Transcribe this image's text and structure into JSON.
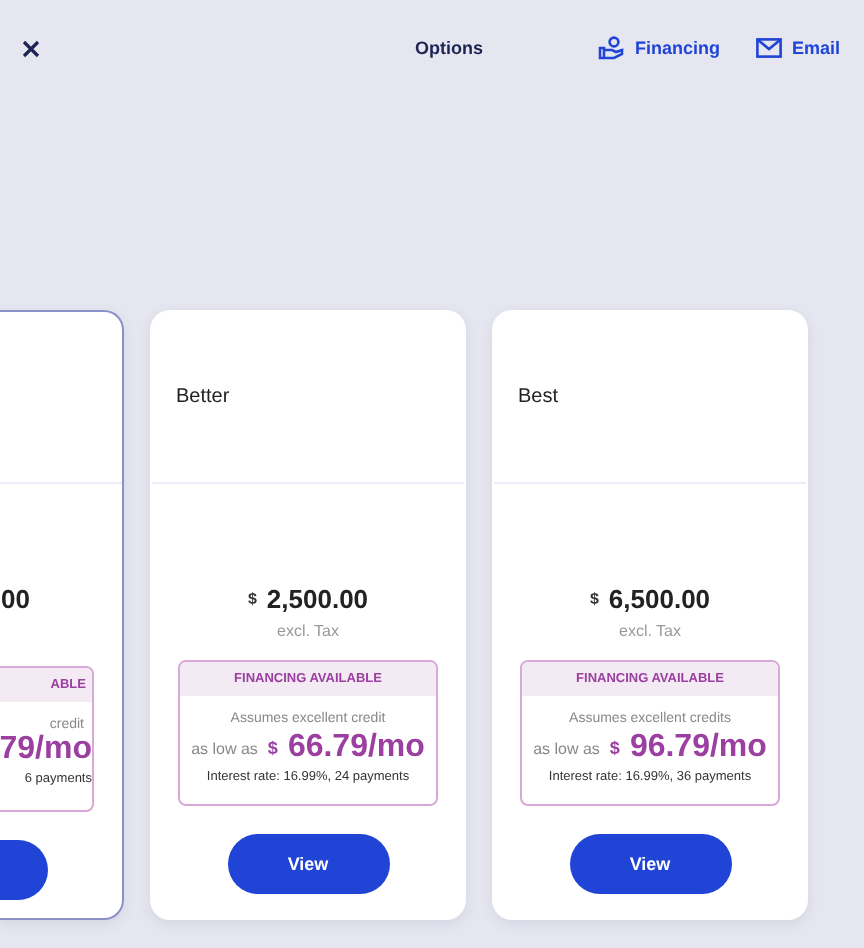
{
  "header": {
    "title": "Options",
    "actions": [
      {
        "kind": "financing",
        "label": "Financing"
      },
      {
        "kind": "email",
        "label": "Email"
      }
    ]
  },
  "options": [
    {
      "kind": "partial",
      "selected": true,
      "price": "00",
      "badge": "ABLE",
      "note": "credit",
      "monthly": "79/mo",
      "terms": "6 payments"
    },
    {
      "kind": "full",
      "selected": false,
      "name": "Better",
      "currency": "$",
      "price": "2,500.00",
      "tax": "excl. Tax",
      "badge": "FINANCING AVAILABLE",
      "note": "Assumes excellent credit",
      "prefix": "as low as",
      "monthly_currency": "$",
      "monthly": "66.79/mo",
      "terms": "Interest rate: 16.99%, 24 payments",
      "button": "View"
    },
    {
      "kind": "full",
      "selected": false,
      "name": "Best",
      "currency": "$",
      "price": "6,500.00",
      "tax": "excl. Tax",
      "badge": "FINANCING AVAILABLE",
      "note": "Assumes excellent credits",
      "prefix": "as low as",
      "monthly_currency": "$",
      "monthly": "96.79/mo",
      "terms": "Interest rate: 16.99%, 36 payments",
      "button": "View"
    }
  ]
}
